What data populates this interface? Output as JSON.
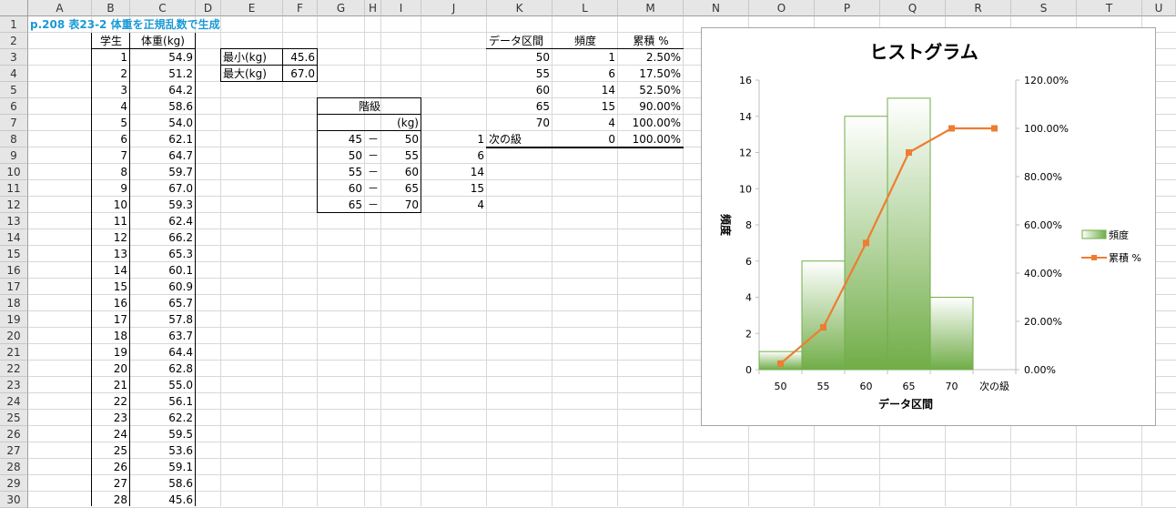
{
  "columns": [
    "A",
    "B",
    "C",
    "D",
    "E",
    "F",
    "G",
    "H",
    "I",
    "J",
    "K",
    "L",
    "M",
    "N",
    "O",
    "P",
    "Q",
    "R",
    "S",
    "T",
    "U"
  ],
  "rows": [
    "1",
    "2",
    "3",
    "4",
    "5",
    "6",
    "7",
    "8",
    "9",
    "10",
    "11",
    "12",
    "13",
    "14",
    "15",
    "16",
    "17",
    "18",
    "19",
    "20",
    "21",
    "22",
    "23",
    "24",
    "25",
    "26",
    "27",
    "28",
    "29",
    "30"
  ],
  "title": "p.208 表23-2 体重を正規乱数で生成",
  "student_table": {
    "header_student": "学生",
    "header_weight": "体重(kg)",
    "rows": [
      {
        "id": "1",
        "w": "54.9"
      },
      {
        "id": "2",
        "w": "51.2"
      },
      {
        "id": "3",
        "w": "64.2"
      },
      {
        "id": "4",
        "w": "58.6"
      },
      {
        "id": "5",
        "w": "54.0"
      },
      {
        "id": "6",
        "w": "62.1"
      },
      {
        "id": "7",
        "w": "64.7"
      },
      {
        "id": "8",
        "w": "59.7"
      },
      {
        "id": "9",
        "w": "67.0"
      },
      {
        "id": "10",
        "w": "59.3"
      },
      {
        "id": "11",
        "w": "62.4"
      },
      {
        "id": "12",
        "w": "66.2"
      },
      {
        "id": "13",
        "w": "65.3"
      },
      {
        "id": "14",
        "w": "60.1"
      },
      {
        "id": "15",
        "w": "60.9"
      },
      {
        "id": "16",
        "w": "65.7"
      },
      {
        "id": "17",
        "w": "57.8"
      },
      {
        "id": "18",
        "w": "63.7"
      },
      {
        "id": "19",
        "w": "64.4"
      },
      {
        "id": "20",
        "w": "62.8"
      },
      {
        "id": "21",
        "w": "55.0"
      },
      {
        "id": "22",
        "w": "56.1"
      },
      {
        "id": "23",
        "w": "62.2"
      },
      {
        "id": "24",
        "w": "59.5"
      },
      {
        "id": "25",
        "w": "53.6"
      },
      {
        "id": "26",
        "w": "59.1"
      },
      {
        "id": "27",
        "w": "58.6"
      },
      {
        "id": "28",
        "w": "45.6"
      }
    ]
  },
  "minmax": {
    "min_label": "最小(kg)",
    "min_value": "45.6",
    "max_label": "最大(kg)",
    "max_value": "67.0"
  },
  "class_table": {
    "header": "階級",
    "unit": "(kg)",
    "dash": "－",
    "rows": [
      {
        "lo": "45",
        "hi": "50",
        "count": "1"
      },
      {
        "lo": "50",
        "hi": "55",
        "count": "6"
      },
      {
        "lo": "55",
        "hi": "60",
        "count": "14"
      },
      {
        "lo": "60",
        "hi": "65",
        "count": "15"
      },
      {
        "lo": "65",
        "hi": "70",
        "count": "4"
      }
    ]
  },
  "freq_table": {
    "header_bin": "データ区間",
    "header_freq": "頻度",
    "header_cum": "累積 %",
    "rows": [
      {
        "bin": "50",
        "freq": "1",
        "cum": "2.50%"
      },
      {
        "bin": "55",
        "freq": "6",
        "cum": "17.50%"
      },
      {
        "bin": "60",
        "freq": "14",
        "cum": "52.50%"
      },
      {
        "bin": "65",
        "freq": "15",
        "cum": "90.00%"
      },
      {
        "bin": "70",
        "freq": "4",
        "cum": "100.00%"
      },
      {
        "bin": "次の級",
        "freq": "0",
        "cum": "100.00%"
      }
    ]
  },
  "chart_data": {
    "type": "bar",
    "title": "ヒストグラム",
    "xlabel": "データ区間",
    "ylabel": "頻度",
    "categories": [
      "50",
      "55",
      "60",
      "65",
      "70",
      "次の級"
    ],
    "series": [
      {
        "name": "頻度",
        "type": "bar",
        "values": [
          1,
          6,
          14,
          15,
          4,
          0
        ],
        "color": "#70ad47"
      },
      {
        "name": "累積 %",
        "type": "line",
        "values": [
          2.5,
          17.5,
          52.5,
          90.0,
          100.0,
          100.0
        ],
        "color": "#ed7d31"
      }
    ],
    "ylim": [
      0,
      16
    ],
    "y_ticks": [
      "0",
      "2",
      "4",
      "6",
      "8",
      "10",
      "12",
      "14",
      "16"
    ],
    "y2lim": [
      0,
      120
    ],
    "y2_ticks": [
      "0.00%",
      "20.00%",
      "40.00%",
      "60.00%",
      "80.00%",
      "100.00%",
      "120.00%"
    ],
    "legend_position": "right",
    "grid": false
  }
}
